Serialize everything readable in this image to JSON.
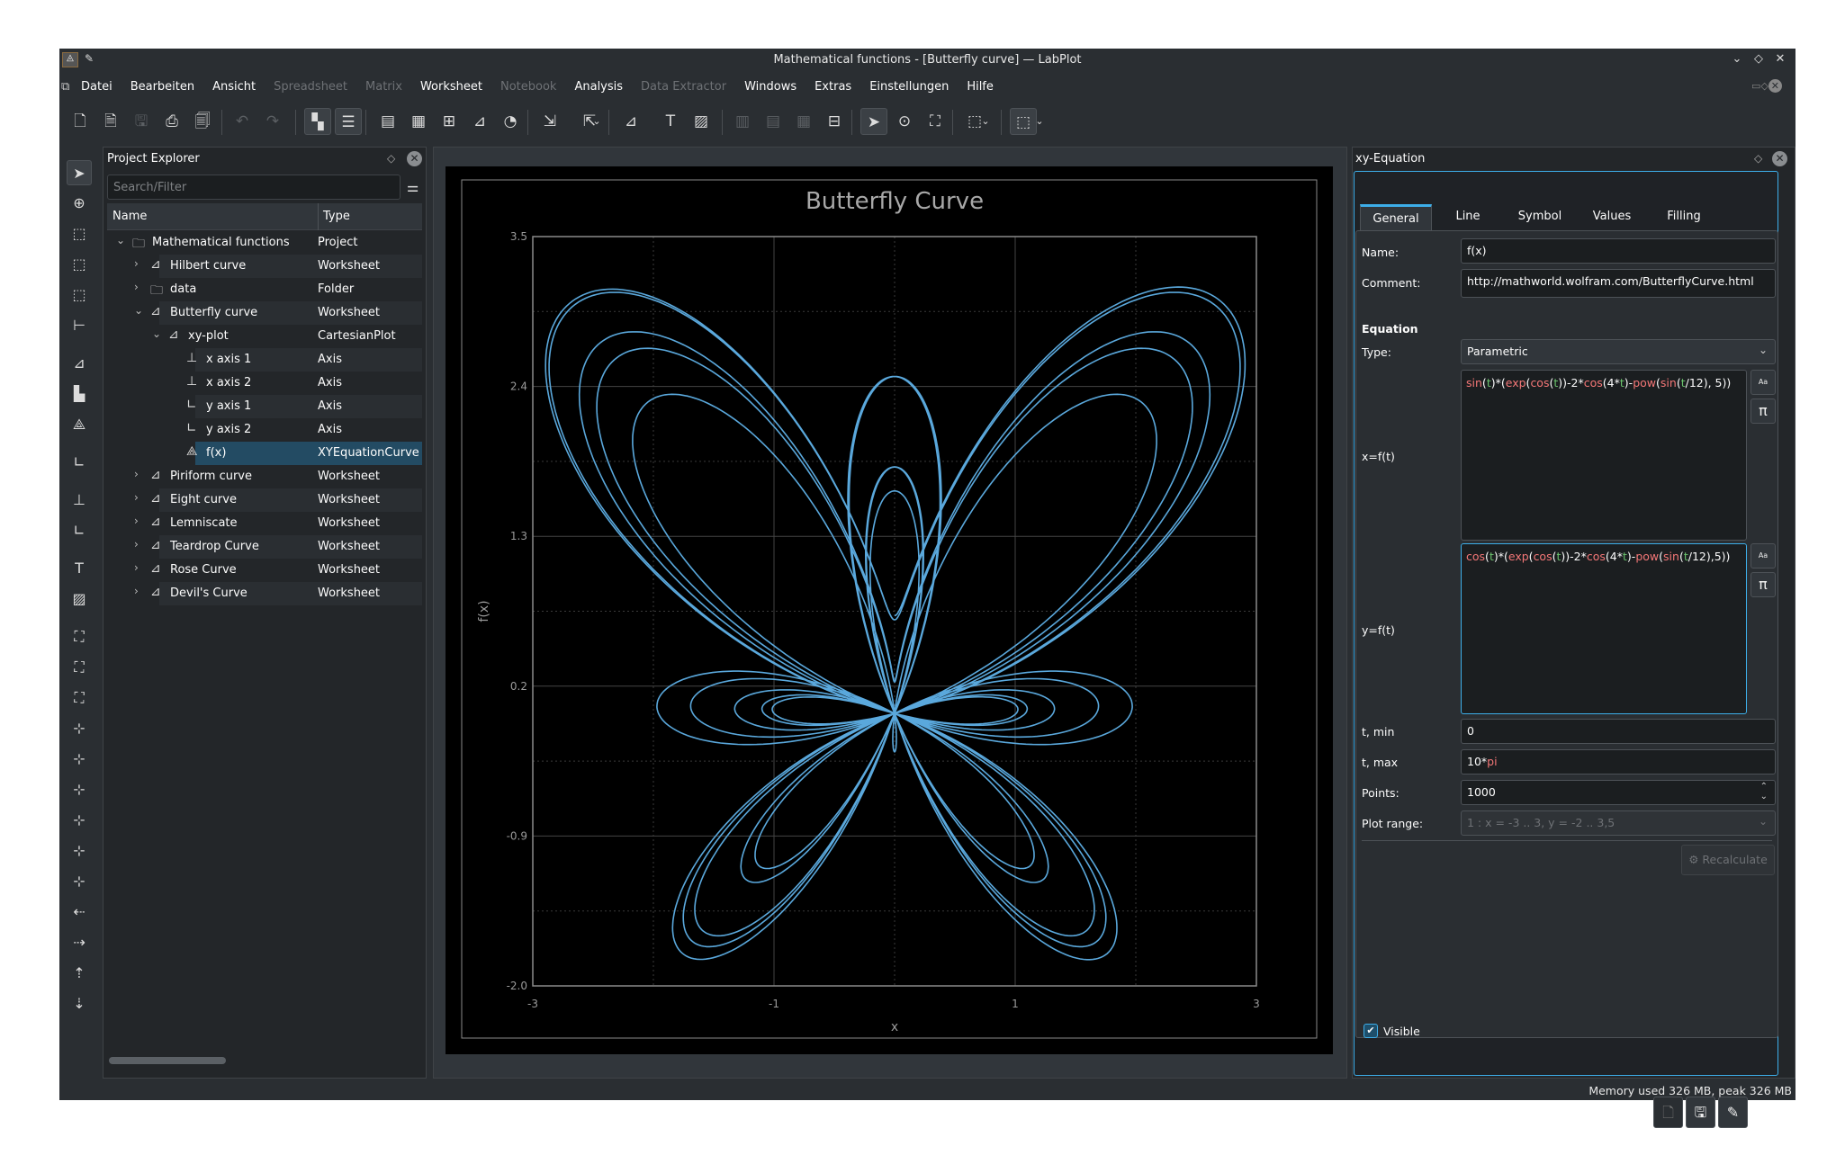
{
  "window": {
    "title": "Mathematical functions - [Butterfly curve] — LabPlot",
    "controls": [
      "minimize",
      "maximize",
      "close"
    ]
  },
  "menu": [
    {
      "label": "Datei",
      "enabled": true
    },
    {
      "label": "Bearbeiten",
      "enabled": true
    },
    {
      "label": "Ansicht",
      "enabled": true
    },
    {
      "label": "Spreadsheet",
      "enabled": false
    },
    {
      "label": "Matrix",
      "enabled": false
    },
    {
      "label": "Worksheet",
      "enabled": true
    },
    {
      "label": "Notebook",
      "enabled": false
    },
    {
      "label": "Analysis",
      "enabled": true
    },
    {
      "label": "Data Extractor",
      "enabled": false
    },
    {
      "label": "Windows",
      "enabled": true
    },
    {
      "label": "Extras",
      "enabled": true
    },
    {
      "label": "Einstellungen",
      "enabled": true
    },
    {
      "label": "Hilfe",
      "enabled": true
    }
  ],
  "toolbar_icons": [
    "new-project",
    "new-file",
    "save",
    "print",
    "print-preview",
    "undo",
    "redo",
    "project-explorer-toggle",
    "properties-toggle",
    "new-spreadsheet",
    "new-matrix",
    "new-datapicker",
    "new-worksheet",
    "new-notebook",
    "import",
    "export",
    "new-plot",
    "add-text",
    "add-image",
    "layout-vertical",
    "layout-horizontal",
    "layout-grid",
    "break-layout",
    "select-mode",
    "zoom-mode",
    "fit-to-page",
    "navigate",
    "cursor"
  ],
  "left_toolbar_icons": [
    "select",
    "crosshair",
    "zoom-select",
    "zoom-select-x",
    "zoom-select-y",
    "cursor",
    "add-curve",
    "add-histogram",
    "add-equation",
    "add-axis",
    "add-x-axis",
    "add-y-axis",
    "add-text",
    "add-image",
    "scale-auto",
    "scale-auto-x",
    "scale-auto-y",
    "zoom-in",
    "zoom-out",
    "zoom-in-x",
    "zoom-out-x",
    "zoom-in-y",
    "zoom-out-y",
    "shift-left",
    "shift-right",
    "shift-up",
    "shift-down"
  ],
  "project_explorer": {
    "title": "Project Explorer",
    "search_placeholder": "Search/Filter",
    "columns": [
      "Name",
      "Type"
    ],
    "rows": [
      {
        "name": "Mathematical functions",
        "type": "Project",
        "level": 0,
        "expanded": true,
        "icon": "folder"
      },
      {
        "name": "Hilbert curve",
        "type": "Worksheet",
        "level": 1,
        "expanded": false,
        "icon": "worksheet"
      },
      {
        "name": "data",
        "type": "Folder",
        "level": 1,
        "expanded": false,
        "icon": "folder"
      },
      {
        "name": "Butterfly curve",
        "type": "Worksheet",
        "level": 1,
        "expanded": true,
        "icon": "worksheet"
      },
      {
        "name": "xy-plot",
        "type": "CartesianPlot",
        "level": 2,
        "expanded": true,
        "icon": "plot"
      },
      {
        "name": "x axis 1",
        "type": "Axis",
        "level": 3,
        "icon": "x-axis"
      },
      {
        "name": "x axis 2",
        "type": "Axis",
        "level": 3,
        "icon": "x-axis"
      },
      {
        "name": "y axis 1",
        "type": "Axis",
        "level": 3,
        "icon": "y-axis"
      },
      {
        "name": "y axis 2",
        "type": "Axis",
        "level": 3,
        "icon": "y-axis"
      },
      {
        "name": "f(x)",
        "type": "XYEquationCurve",
        "level": 3,
        "icon": "equation-curve",
        "selected": true
      },
      {
        "name": "Piriform curve",
        "type": "Worksheet",
        "level": 1,
        "expanded": false,
        "icon": "worksheet"
      },
      {
        "name": "Eight curve",
        "type": "Worksheet",
        "level": 1,
        "expanded": false,
        "icon": "worksheet"
      },
      {
        "name": "Lemniscate",
        "type": "Worksheet",
        "level": 1,
        "expanded": false,
        "icon": "worksheet"
      },
      {
        "name": "Teardrop Curve",
        "type": "Worksheet",
        "level": 1,
        "expanded": false,
        "icon": "worksheet"
      },
      {
        "name": "Rose Curve",
        "type": "Worksheet",
        "level": 1,
        "expanded": false,
        "icon": "worksheet"
      },
      {
        "name": "Devil's Curve",
        "type": "Worksheet",
        "level": 1,
        "expanded": false,
        "icon": "worksheet"
      }
    ]
  },
  "chart_data": {
    "type": "line",
    "title": "Butterfly Curve",
    "xlabel": "x",
    "ylabel": "f(x)",
    "xlim": [
      -3,
      3
    ],
    "ylim": [
      -2.0,
      3.5
    ],
    "xticks": [
      "-3",
      "-1",
      "1",
      "3"
    ],
    "yticks": [
      "-2.0",
      "-0.9",
      "0.2",
      "1.3",
      "2.4",
      "3.5"
    ],
    "xtick_values": [
      -3,
      -1,
      1,
      3
    ],
    "ytick_values": [
      -2.0,
      -0.9,
      0.2,
      1.3,
      2.4,
      3.5
    ],
    "grid": true,
    "series": [
      {
        "kind": "parametric",
        "x_expr": "sin(t)*(exp(cos(t))-2*cos(4*t)-pow(sin(t/12), 5))",
        "y_expr": "cos(t)*(exp(cos(t))-2*cos(4*t)-pow(sin(t/12),5))",
        "t_min": 0,
        "t_max": "10*pi",
        "points": 1000,
        "color": "#5aa8dc"
      }
    ]
  },
  "properties": {
    "title": "xy-Equation",
    "tabs": [
      "General",
      "Line",
      "Symbol",
      "Values",
      "Filling"
    ],
    "active_tab": "General",
    "name_label": "Name:",
    "name": "f(x)",
    "comment_label": "Comment:",
    "comment": "http://mathworld.wolfram.com/ButterflyCurve.html",
    "equation_heading": "Equation",
    "type_label": "Type:",
    "type": "Parametric",
    "x_label": "x=f(t)",
    "x_expr": "sin(t)*(exp(cos(t))-2*cos(4*t)-pow(sin(t/12), 5))",
    "y_label": "y=f(t)",
    "y_expr": "cos(t)*(exp(cos(t))-2*cos(4*t)-pow(sin(t/12),5))",
    "tmin_label": "t, min",
    "tmin": "0",
    "tmax_label": "t, max",
    "tmax": "10*pi",
    "points_label": "Points:",
    "points": "1000",
    "plot_range_label": "Plot range:",
    "plot_range": "1 : x = -3 .. 3, y = -2 .. 3,5",
    "recalculate": "Recalculate",
    "visible_label": "Visible",
    "visible": true
  },
  "status": {
    "memory": "Memory used 326 MB, peak 326 MB"
  },
  "colors": {
    "accent": "#3daee9",
    "curve": "#5aa8dc",
    "function_token": "#f47777",
    "variable_token": "#6bc46d",
    "selection": "#234b63"
  }
}
